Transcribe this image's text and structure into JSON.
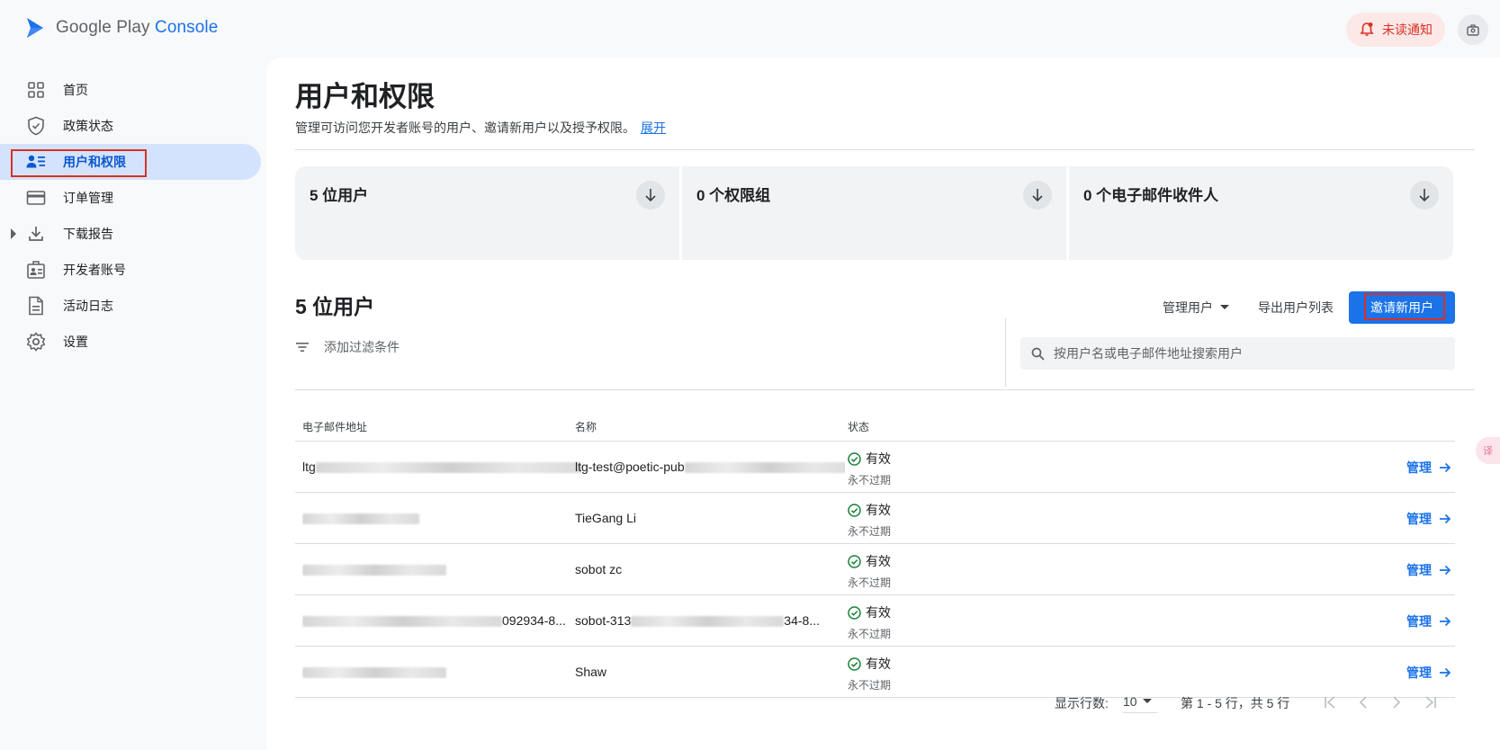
{
  "header": {
    "logo_google_play": "Google Play",
    "logo_console": "Console",
    "notification_label": "未读通知"
  },
  "sidebar": {
    "items": [
      {
        "label": "首页",
        "icon": "grid-icon"
      },
      {
        "label": "政策状态",
        "icon": "shield-check-icon"
      },
      {
        "label": "用户和权限",
        "icon": "user-list-icon",
        "active": true
      },
      {
        "label": "订单管理",
        "icon": "credit-card-icon"
      },
      {
        "label": "下载报告",
        "icon": "download-icon",
        "expandable": true
      },
      {
        "label": "开发者账号",
        "icon": "id-badge-icon"
      },
      {
        "label": "活动日志",
        "icon": "document-icon"
      },
      {
        "label": "设置",
        "icon": "gear-icon"
      }
    ]
  },
  "page": {
    "title": "用户和权限",
    "description": "管理可访问您开发者账号的用户、邀请新用户以及授予权限。",
    "expand_link": "展开"
  },
  "summary_cards": [
    {
      "title": "5 位用户"
    },
    {
      "title": "0 个权限组"
    },
    {
      "title": "0 个电子邮件收件人"
    }
  ],
  "users_section": {
    "title": "5 位用户",
    "manage_users": "管理用户",
    "export_list": "导出用户列表",
    "invite_button": "邀请新用户",
    "filter_label": "添加过滤条件",
    "search_placeholder": "按用户名或电子邮件地址搜索用户"
  },
  "table": {
    "headers": {
      "email": "电子邮件地址",
      "name": "名称",
      "status": "状态"
    },
    "rows": [
      {
        "email_prefix": "ltg",
        "email_suffix": "",
        "name_prefix": "ltg-test@poetic-pub",
        "name_suffix": "",
        "status": "有效",
        "status_sub": "永不过期",
        "action": "管理"
      },
      {
        "email_prefix": "",
        "email_suffix": "",
        "name_prefix": "TieGang Li",
        "name_suffix": "",
        "status": "有效",
        "status_sub": "永不过期",
        "action": "管理"
      },
      {
        "email_prefix": "",
        "email_suffix": "",
        "name_prefix": "sobot zc",
        "name_suffix": "",
        "status": "有效",
        "status_sub": "永不过期",
        "action": "管理"
      },
      {
        "email_prefix": "",
        "email_suffix": "092934-8...",
        "name_prefix": "sobot-313",
        "name_suffix": "34-8...",
        "status": "有效",
        "status_sub": "永不过期",
        "action": "管理"
      },
      {
        "email_prefix": "",
        "email_suffix": "",
        "name_prefix": "Shaw",
        "name_suffix": "",
        "status": "有效",
        "status_sub": "永不过期",
        "action": "管理"
      }
    ]
  },
  "pagination": {
    "rows_label": "显示行数:",
    "rows_value": "10",
    "page_info": "第 1 - 5 行，共 5 行"
  },
  "colors": {
    "accent": "#1a73e8",
    "active_nav_bg": "#d3e3fd",
    "notification_bg": "#fce8e6",
    "notification_fg": "#d93025",
    "status_ok": "#188038",
    "highlight_border": "#d93025"
  }
}
